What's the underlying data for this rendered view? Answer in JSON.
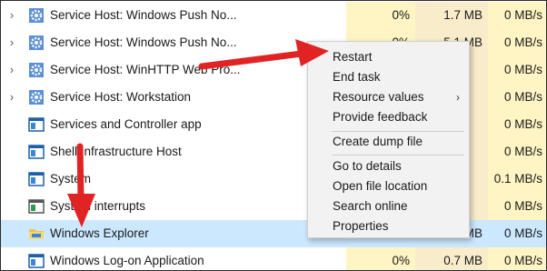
{
  "processes": [
    {
      "name": "Service Host: Windows Push No...",
      "icon": "gear-icon",
      "expandable": true,
      "cpu": "0%",
      "memory": "1.7 MB",
      "disk": "0 MB/s"
    },
    {
      "name": "Service Host: Windows Push No...",
      "icon": "gear-icon",
      "expandable": true,
      "cpu": "0%",
      "memory": "5.1 MB",
      "disk": "0 MB/s"
    },
    {
      "name": "Service Host: WinHTTP Web Pro...",
      "icon": "gear-icon",
      "expandable": true,
      "cpu": "",
      "memory": "",
      "disk": "0 MB/s"
    },
    {
      "name": "Service Host: Workstation",
      "icon": "gear-icon",
      "expandable": true,
      "cpu": "",
      "memory": "",
      "disk": "0 MB/s"
    },
    {
      "name": "Services and Controller app",
      "icon": "window-app-icon",
      "expandable": false,
      "cpu": "",
      "memory": "",
      "disk": "0 MB/s"
    },
    {
      "name": "Shell Infrastructure Host",
      "icon": "window-app-icon",
      "expandable": false,
      "cpu": "",
      "memory": "",
      "disk": "0 MB/s"
    },
    {
      "name": "System",
      "icon": "window-app-icon",
      "expandable": false,
      "cpu": "",
      "memory": "",
      "disk": "0.1 MB/s"
    },
    {
      "name": "System interrupts",
      "icon": "window-app-icon",
      "expandable": false,
      "cpu": "",
      "memory": "",
      "disk": "0 MB/s"
    },
    {
      "name": "Windows Explorer",
      "icon": "folder-icon",
      "expandable": false,
      "selected": true,
      "cpu": "",
      "memory": "MB",
      "disk": "0 MB/s"
    },
    {
      "name": "Windows Log-on Application",
      "icon": "window-app-icon",
      "expandable": false,
      "cpu": "0%",
      "memory": "0.7 MB",
      "disk": "0 MB/s"
    }
  ],
  "context_menu": {
    "groups": [
      [
        {
          "label": "Restart"
        },
        {
          "label": "End task"
        },
        {
          "label": "Resource values",
          "submenu": true
        },
        {
          "label": "Provide feedback"
        }
      ],
      [
        {
          "label": "Create dump file"
        }
      ],
      [
        {
          "label": "Go to details"
        },
        {
          "label": "Open file location"
        },
        {
          "label": "Search online"
        },
        {
          "label": "Properties"
        }
      ]
    ],
    "submenu_glyph": "›"
  },
  "colors": {
    "selected_row": "#cce8ff",
    "heat_light": "#fff4c4",
    "heat_medium": "#f9eccb",
    "annotation_arrow": "#e02424"
  }
}
